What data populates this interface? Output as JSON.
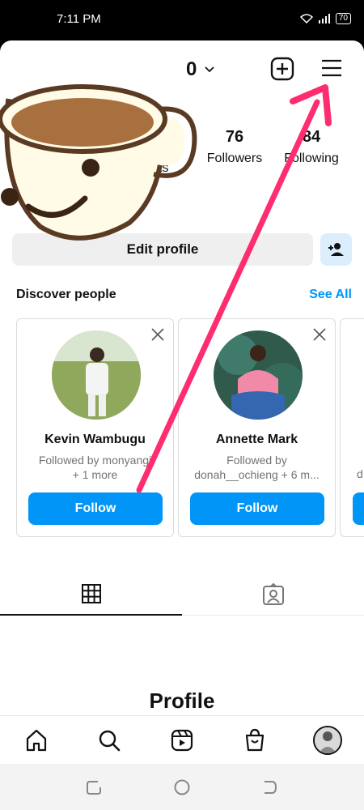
{
  "status": {
    "time": "7:11 PM",
    "battery": "70"
  },
  "header": {
    "username_visible": "0",
    "create_icon": "plus-square-icon",
    "menu_icon": "hamburger-icon"
  },
  "stats": [
    {
      "value": "76",
      "label": "Followers"
    },
    {
      "value": "84",
      "label": "Following"
    }
  ],
  "partial_stat_label": "ts",
  "edit_profile_label": "Edit profile",
  "discover": {
    "title": "Discover people",
    "see_all": "See All",
    "cards": [
      {
        "name": "Kevin Wambugu",
        "sub1": "Followed by monyangi",
        "sub2": "+ 1 more",
        "button": "Follow"
      },
      {
        "name": "Annette Mark",
        "sub1": "Followed by",
        "sub2": "donah__ochieng + 6 m...",
        "button": "Follow"
      }
    ],
    "partial_card_text": "d"
  },
  "tabs": [
    {
      "icon": "grid-icon"
    },
    {
      "icon": "tagged-icon"
    }
  ],
  "profile_heading": "Profile",
  "bottom_nav": [
    {
      "icon": "home-icon"
    },
    {
      "icon": "search-icon"
    },
    {
      "icon": "reels-icon"
    },
    {
      "icon": "shop-icon"
    },
    {
      "icon": "profile-avatar-icon"
    }
  ],
  "colors": {
    "accent": "#0095f6",
    "arrow": "#ff2d6f"
  }
}
